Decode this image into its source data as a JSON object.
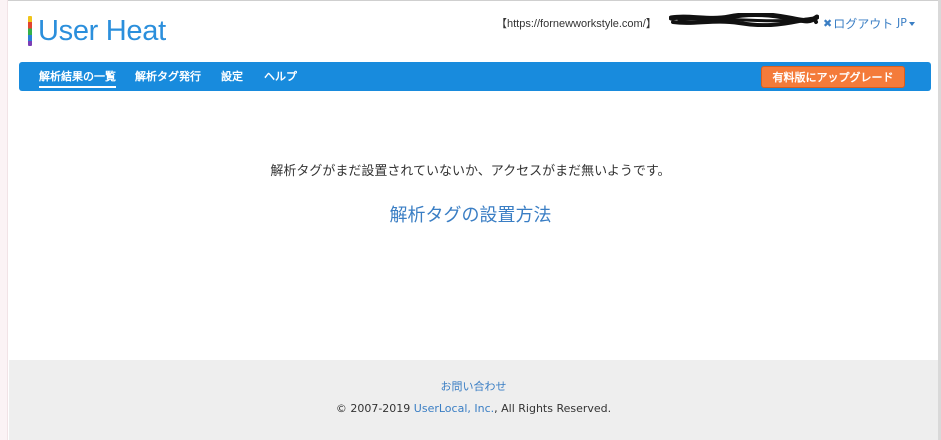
{
  "header": {
    "logo_text": "User Heat",
    "site_url": "【https://fornewworkstyle.com/】",
    "logout_label": "ログアウト",
    "logout_icon": "close-x-icon",
    "lang_label": "JP"
  },
  "nav": {
    "items": [
      {
        "label": "解析結果の一覧",
        "active": true
      },
      {
        "label": "解析タグ発行"
      },
      {
        "label": "設定"
      },
      {
        "label": "ヘルプ"
      }
    ],
    "upgrade_label": "有料版にアップグレード",
    "bar_color": "#188bdd",
    "upgrade_color": "#f47b3a"
  },
  "main": {
    "message": "解析タグがまだ設置されていないか、アクセスがまだ無いようです。",
    "setup_link": "解析タグの設置方法"
  },
  "footer": {
    "contact_link": "お問い合わせ",
    "copyright_prefix": "© 2007-2019 ",
    "company_link": "UserLocal, Inc.",
    "copyright_suffix": ", All Rights Reserved."
  }
}
